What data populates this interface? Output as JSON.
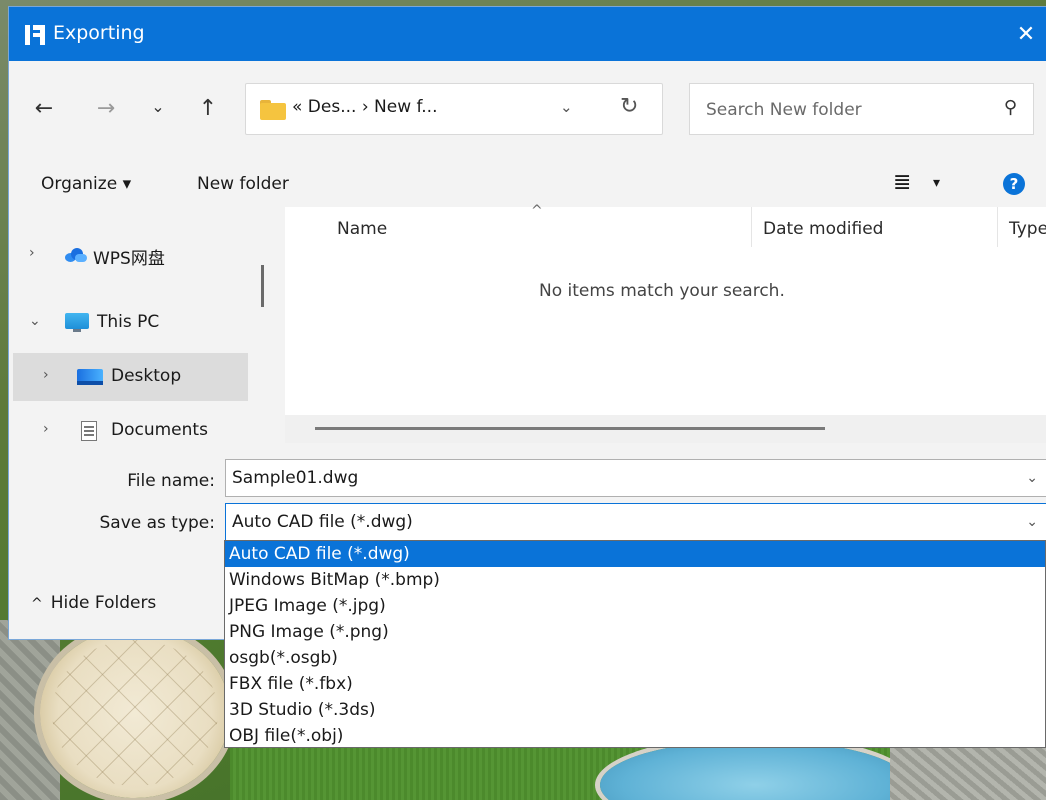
{
  "dialog": {
    "title": "Exporting",
    "close_glyph": "✕"
  },
  "nav": {
    "back_glyph": "←",
    "forward_glyph": "→",
    "recent_glyph": "⌄",
    "up_glyph": "↑",
    "address_path": "« Des... › New f...",
    "address_chevron": "⌄",
    "refresh_glyph": "↻",
    "search_placeholder": "Search New folder",
    "search_icon_glyph": "⚲"
  },
  "toolbar": {
    "organize_label": "Organize ▾",
    "new_folder_label": "New folder",
    "view_glyph": "≣",
    "view_caret": "▾",
    "help_glyph": "?"
  },
  "sidebar": {
    "items": [
      {
        "label": "WPS网盘",
        "chevron": "›",
        "icon": "cloud-icon",
        "selected": false
      },
      {
        "label": "This PC",
        "chevron": "⌄",
        "icon": "pc-icon",
        "selected": false
      },
      {
        "label": "Desktop",
        "chevron": "›",
        "icon": "desktop-icon",
        "selected": true
      },
      {
        "label": "Documents",
        "chevron": "›",
        "icon": "document-icon",
        "selected": false
      }
    ]
  },
  "file_list": {
    "columns": [
      "Name",
      "Date modified",
      "Type"
    ],
    "sort_glyph": "^",
    "empty_message": "No items match your search."
  },
  "form": {
    "file_name_label": "File name:",
    "file_name_value": "Sample01.dwg",
    "save_type_label": "Save as type:",
    "save_type_value": "Auto CAD file (*.dwg)",
    "combo_chevron": "⌄",
    "hide_folders_chevron": "^",
    "hide_folders_label": "Hide Folders"
  },
  "save_type_options": [
    "Auto CAD file (*.dwg)",
    "Windows BitMap (*.bmp)",
    "JPEG Image (*.jpg)",
    "PNG Image (*.png)",
    "osgb(*.osgb)",
    "FBX file (*.fbx)",
    "3D Studio (*.3ds)",
    "OBJ file(*.obj)"
  ],
  "colors": {
    "accent": "#0a73d8",
    "selection_bg": "#dcdcdc"
  }
}
